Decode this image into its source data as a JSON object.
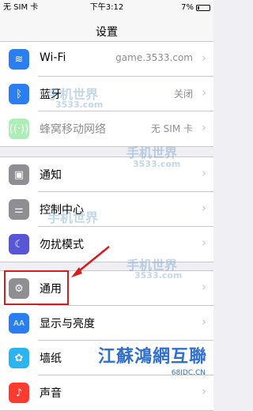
{
  "status": {
    "carrier": "无 SIM 卡",
    "time": "下午3:12",
    "battery": "7%"
  },
  "nav": {
    "title": "设置"
  },
  "group1": [
    {
      "label": "Wi-Fi",
      "value": "game.3533.com",
      "icon": "wifi-icon",
      "color": "#2a7ef0"
    },
    {
      "label": "蓝牙",
      "value": "关闭",
      "icon": "bluetooth-icon",
      "color": "#2a7ef0"
    },
    {
      "label": "蜂窝移动网络",
      "value": "无 SIM 卡",
      "icon": "cellular-icon",
      "color": "#4cd964"
    }
  ],
  "group2": [
    {
      "label": "通知",
      "icon": "notifications-icon",
      "color": "#8e8e93"
    },
    {
      "label": "控制中心",
      "icon": "control-center-icon",
      "color": "#8e8e93"
    },
    {
      "label": "勿扰模式",
      "icon": "do-not-disturb-icon",
      "color": "#5856d6"
    }
  ],
  "group3": [
    {
      "label": "通用",
      "icon": "gear-icon",
      "color": "#8e8e93"
    },
    {
      "label": "显示与亮度",
      "icon": "display-icon",
      "color": "#2a7ef0"
    },
    {
      "label": "墙纸",
      "icon": "wallpaper-icon",
      "color": "#2ab4f0"
    },
    {
      "label": "声音",
      "icon": "sound-icon",
      "color": "#ff3b30"
    }
  ],
  "watermarks": {
    "brand": "手机世界",
    "site": "3533.com",
    "banner": "江蘇鴻網互聯",
    "banner_site": "68IDC.CN"
  }
}
